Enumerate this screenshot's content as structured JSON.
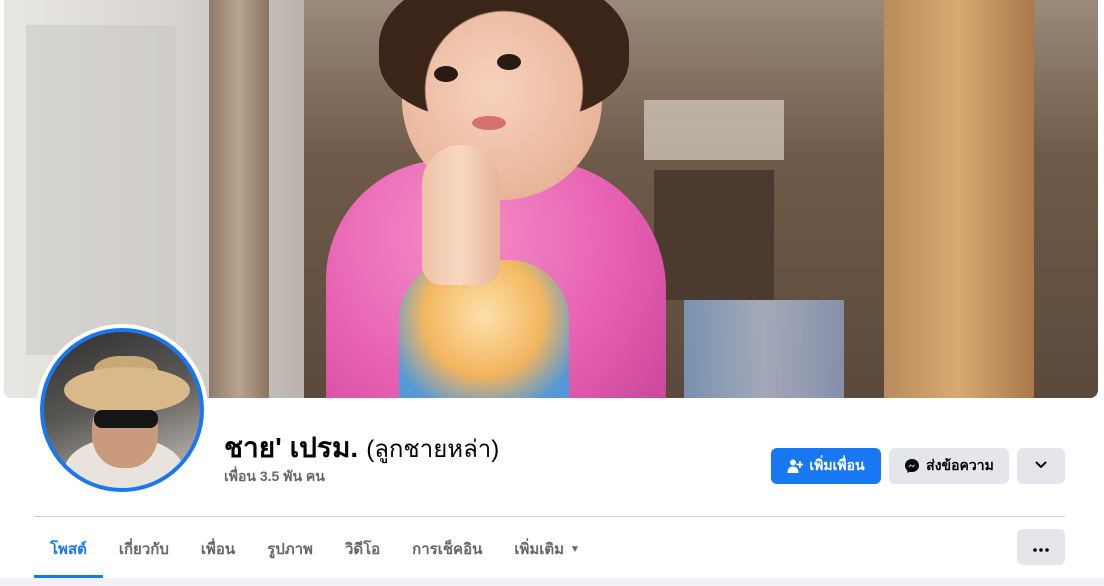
{
  "profile": {
    "name": "ชาย' เปรม.",
    "alternate_name": "(ลูกชายหล่า)",
    "friends_count": "เพื่อน 3.5 พัน คน"
  },
  "actions": {
    "add_friend_label": "เพิ่มเพื่อน",
    "message_label": "ส่งข้อความ"
  },
  "tabs": [
    {
      "label": "โพสต์",
      "active": true
    },
    {
      "label": "เกี่ยวกับ",
      "active": false
    },
    {
      "label": "เพื่อน",
      "active": false
    },
    {
      "label": "รูปภาพ",
      "active": false
    },
    {
      "label": "วิดีโอ",
      "active": false
    },
    {
      "label": "การเช็คอิน",
      "active": false
    },
    {
      "label": "เพิ่มเติม",
      "active": false
    }
  ],
  "colors": {
    "accent": "#1877f2",
    "button_gray": "#e4e6eb",
    "text_secondary": "#65676b"
  },
  "icons": {
    "add_friend": "person-plus-icon",
    "message": "messenger-icon",
    "dropdown": "chevron-down-icon",
    "more": "more-dots-icon",
    "tab_more_caret": "caret-down-icon"
  }
}
